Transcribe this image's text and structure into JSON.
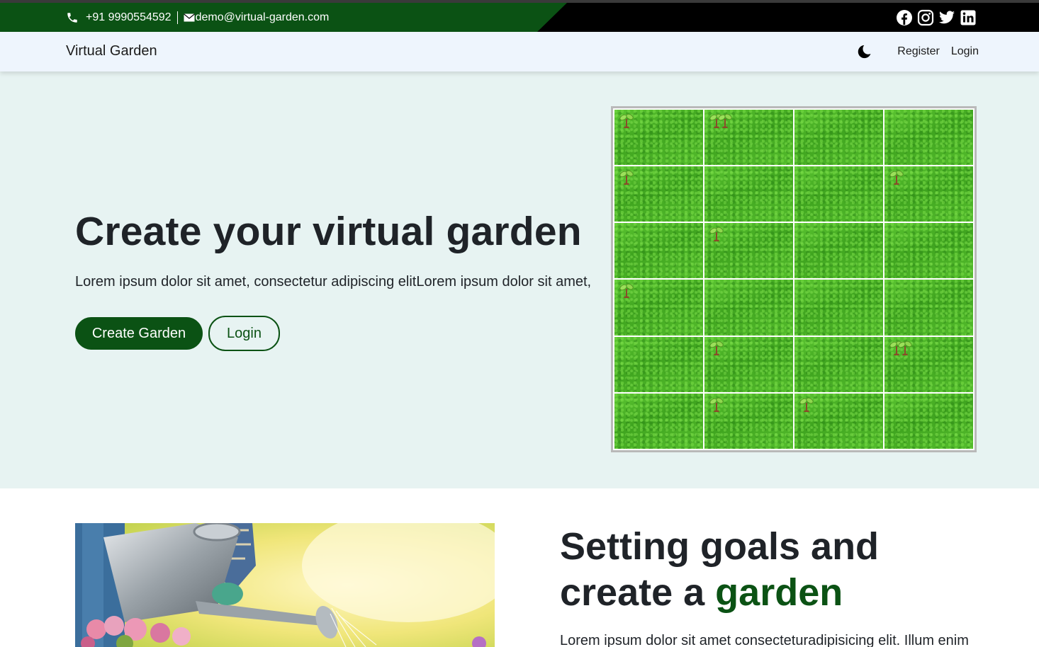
{
  "topbar": {
    "phone": "+91 9990554592",
    "email": "demo@virtual-garden.com",
    "socials": [
      "facebook-icon",
      "instagram-icon",
      "twitter-icon",
      "linkedin-icon"
    ]
  },
  "navbar": {
    "brand": "Virtual Garden",
    "theme_toggle_icon": "moon-icon",
    "links": {
      "register": "Register",
      "login": "Login"
    }
  },
  "hero": {
    "title": "Create your virtual garden",
    "text": "Lorem ipsum dolor sit amet, consectetur adipiscing elitLorem ipsum dolor sit amet,",
    "primary_button": "Create Garden",
    "secondary_button": "Login"
  },
  "garden": {
    "rows": 6,
    "cols": 4,
    "plants": [
      {
        "row": 0,
        "col": 0,
        "count": 1
      },
      {
        "row": 0,
        "col": 1,
        "count": 2
      },
      {
        "row": 1,
        "col": 0,
        "count": 1
      },
      {
        "row": 1,
        "col": 3,
        "count": 1
      },
      {
        "row": 2,
        "col": 1,
        "count": 1
      },
      {
        "row": 3,
        "col": 0,
        "count": 1
      },
      {
        "row": 4,
        "col": 1,
        "count": 1
      },
      {
        "row": 4,
        "col": 3,
        "count": 2
      },
      {
        "row": 5,
        "col": 1,
        "count": 1
      },
      {
        "row": 5,
        "col": 2,
        "count": 1
      }
    ]
  },
  "section2": {
    "title_part1": "Setting goals and",
    "title_part2": "create a ",
    "title_accent": "garden",
    "text": "Lorem ipsum dolor sit amet consecteturadipisicing elit. Illum enim"
  },
  "colors": {
    "brand_green": "#0b5214",
    "hero_bg": "#e7f3f2",
    "navbar_bg": "#eef5fd"
  }
}
